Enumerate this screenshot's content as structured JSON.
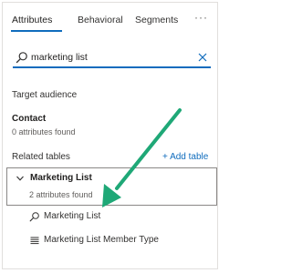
{
  "tabs": [
    {
      "label": "Attributes",
      "active": true
    },
    {
      "label": "Behavioral",
      "active": false
    },
    {
      "label": "Segments",
      "active": false
    }
  ],
  "more_label": "···",
  "search": {
    "value": "marketing list",
    "icon": "search-icon",
    "clear_icon": "close-icon"
  },
  "target_audience": {
    "heading": "Target audience",
    "entity": "Contact",
    "count": "0 attributes found"
  },
  "related_tables": {
    "heading": "Related tables",
    "add_label": "+ Add table",
    "table": {
      "name": "Marketing List",
      "count": "2 attributes found",
      "items": [
        {
          "label": "Marketing List",
          "icon": "search-icon"
        },
        {
          "label": "Marketing List Member Type",
          "icon": "list-icon"
        }
      ]
    }
  },
  "colors": {
    "accent": "#0f6cbd",
    "annotation_arrow": "#1fa877"
  }
}
